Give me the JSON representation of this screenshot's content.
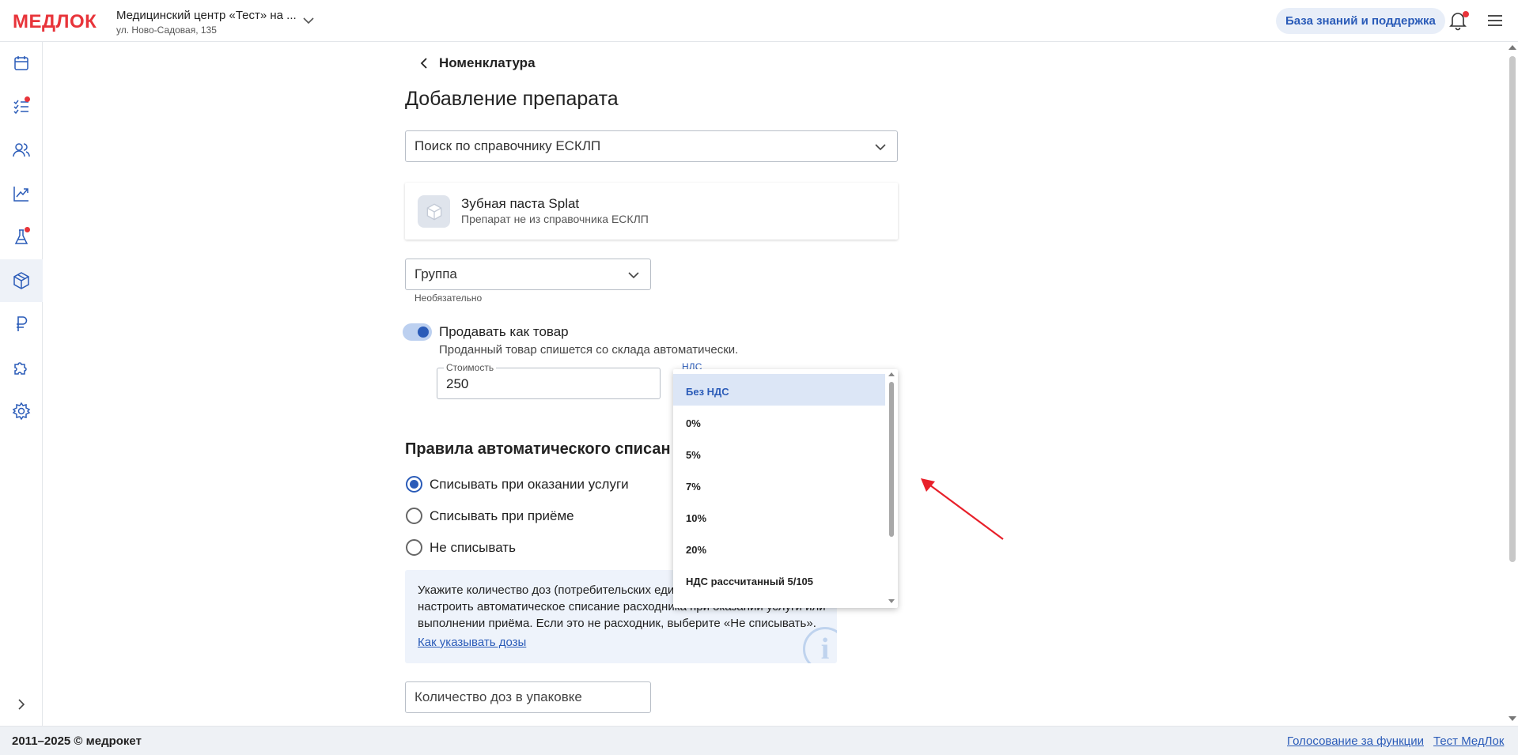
{
  "header": {
    "logo": "МЕДЛОК",
    "clinic_name": "Медицинский центр «Тест» на ...",
    "clinic_address": "ул. Ново-Садовая, 135",
    "kb_button": "База знаний и поддержка",
    "icons": [
      "chevron-down-icon",
      "bell-icon",
      "menu-icon"
    ]
  },
  "sidebar": {
    "items": [
      {
        "icon": "calendar-icon",
        "badge": false
      },
      {
        "icon": "checklist-icon",
        "badge": true
      },
      {
        "icon": "users-icon",
        "badge": false
      },
      {
        "icon": "chart-icon",
        "badge": false
      },
      {
        "icon": "flask-icon",
        "badge": true
      },
      {
        "icon": "box-icon",
        "badge": false,
        "active": true
      },
      {
        "icon": "ruble-icon",
        "badge": false
      },
      {
        "icon": "puzzle-icon",
        "badge": false
      },
      {
        "icon": "gear-icon",
        "badge": false
      }
    ],
    "expand_icon": "chevron-right-icon"
  },
  "breadcrumb": {
    "back_label": "Номенклатура"
  },
  "page_title": "Добавление препарата",
  "search": {
    "value": "Поиск по справочнику ЕСКЛП"
  },
  "drug": {
    "name": "Зубная паста Splat",
    "subtitle": "Препарат не из справочника ЕСКЛП"
  },
  "group": {
    "value": "Группа",
    "hint": "Необязательно"
  },
  "sell_toggle": {
    "on": true,
    "label": "Продавать как товар",
    "description": "Проданный товар спишется со склада автоматически."
  },
  "cost": {
    "label": "Стоимость",
    "value": "250"
  },
  "nds": {
    "label": "НДС"
  },
  "dropdown": {
    "options": [
      "Без НДС",
      "0%",
      "5%",
      "7%",
      "10%",
      "20%",
      "НДС рассчитанный 5/105"
    ],
    "selected": "Без НДС"
  },
  "writeoff": {
    "title": "Правила автоматического списан",
    "options": [
      {
        "label": "Списывать при оказании услуги",
        "selected": true
      },
      {
        "label": "Списывать при приёме",
        "selected": false
      },
      {
        "label": "Не списывать",
        "selected": false
      }
    ]
  },
  "info": {
    "text": "Укажите количество доз (потребительских еди... настроить автоматическое списание расходника при оказании услуги или выполнении приёма. Если это не расходник, выберите «Не списывать».",
    "line1": "Укажите количество доз (потребительских еди",
    "line2": "настроить автоматическое списание расходника при оказании услуги или",
    "line3": "выполнении приёма. Если это не расходник, выберите «Не списывать».",
    "link": "Как указывать дозы"
  },
  "doses": {
    "placeholder": "Количество доз в упаковке"
  },
  "footer": {
    "copyright": "2011–2025 © медрокет",
    "links": [
      "Голосование за функции",
      "Тест МедЛок"
    ]
  },
  "colors": {
    "accent": "#2a5bb8",
    "logo": "#e8343a",
    "annotation_arrow": "#e8202a"
  }
}
